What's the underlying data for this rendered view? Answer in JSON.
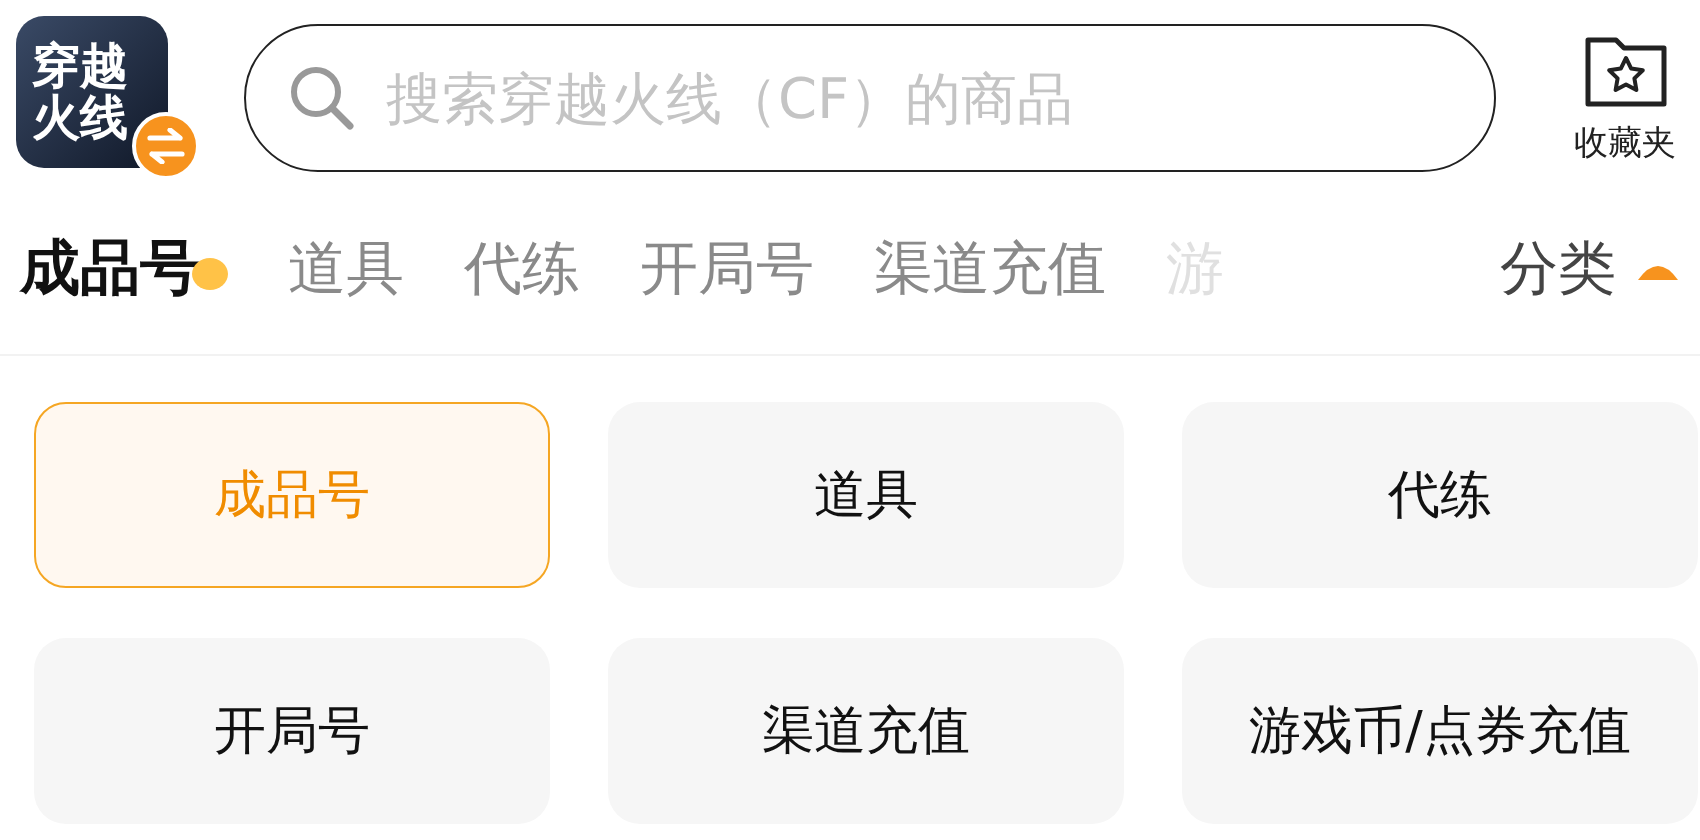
{
  "header": {
    "logo_text": "穿越火线",
    "search": {
      "placeholder": "搜索穿越火线（CF）的商品"
    },
    "favorites": {
      "label": "收藏夹"
    }
  },
  "tabs": [
    {
      "label": "成品号",
      "selected": true,
      "faded": false
    },
    {
      "label": "道具",
      "selected": false,
      "faded": false
    },
    {
      "label": "代练",
      "selected": false,
      "faded": false
    },
    {
      "label": "开局号",
      "selected": false,
      "faded": false
    },
    {
      "label": "渠道充值",
      "selected": false,
      "faded": false
    },
    {
      "label": "游",
      "selected": false,
      "faded": true
    }
  ],
  "category_button": {
    "label": "分类",
    "expanded": true
  },
  "categories": [
    {
      "label": "成品号",
      "selected": true
    },
    {
      "label": "道具",
      "selected": false
    },
    {
      "label": "代练",
      "selected": false
    },
    {
      "label": "开局号",
      "selected": false
    },
    {
      "label": "渠道充值",
      "selected": false
    },
    {
      "label": "游戏币/点券充值",
      "selected": false
    }
  ]
}
